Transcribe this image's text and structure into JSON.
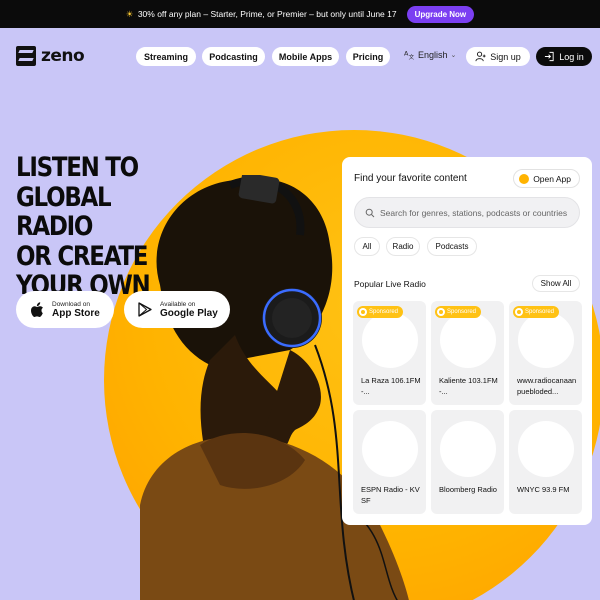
{
  "promo": {
    "icon": "sun-icon",
    "text": "30% off any plan – Starter, Prime, or Premier – but only until June 17",
    "cta": "Upgrade Now"
  },
  "nav": {
    "logo": "zeno",
    "items": [
      {
        "label": "Streaming"
      },
      {
        "label": "Podcasting"
      },
      {
        "label": "Mobile Apps"
      },
      {
        "label": "Pricing"
      }
    ],
    "language": "English",
    "signup": "Sign up",
    "login": "Log in"
  },
  "hero": {
    "headline": [
      "LISTEN TO",
      "GLOBAL RADIO",
      "OR CREATE",
      "YOUR OWN"
    ],
    "app_store": {
      "small": "Download on",
      "big": "App Store",
      "icon": "apple-icon"
    },
    "google_play": {
      "small": "Available on",
      "big": "Google Play",
      "icon": "play-store-icon"
    }
  },
  "finder": {
    "title": "Find your favorite content",
    "open_app": "Open App",
    "search_placeholder": "Search for genres, stations, podcasts or countries",
    "filters": [
      "All",
      "Radio",
      "Podcasts"
    ],
    "section_title": "Popular Live Radio",
    "show_all": "Show All",
    "stations": [
      {
        "name": "La Raza 106.1FM -...",
        "sponsored": true
      },
      {
        "name": "Kaliente 103.1FM -...",
        "sponsored": true
      },
      {
        "name": "www.radiocanaanpuebloded...",
        "sponsored": true
      },
      {
        "name": "ESPN Radio - KVSF",
        "sponsored": false
      },
      {
        "name": "Bloomberg Radio",
        "sponsored": false
      },
      {
        "name": "WNYC 93.9 FM",
        "sponsored": false
      }
    ],
    "sponsored_label": "Sponsored"
  },
  "colors": {
    "background": "#c9c6f7",
    "accent": "#7b3ff2",
    "sun": "#ffb300",
    "sponsored_badge": "#ffc214"
  }
}
